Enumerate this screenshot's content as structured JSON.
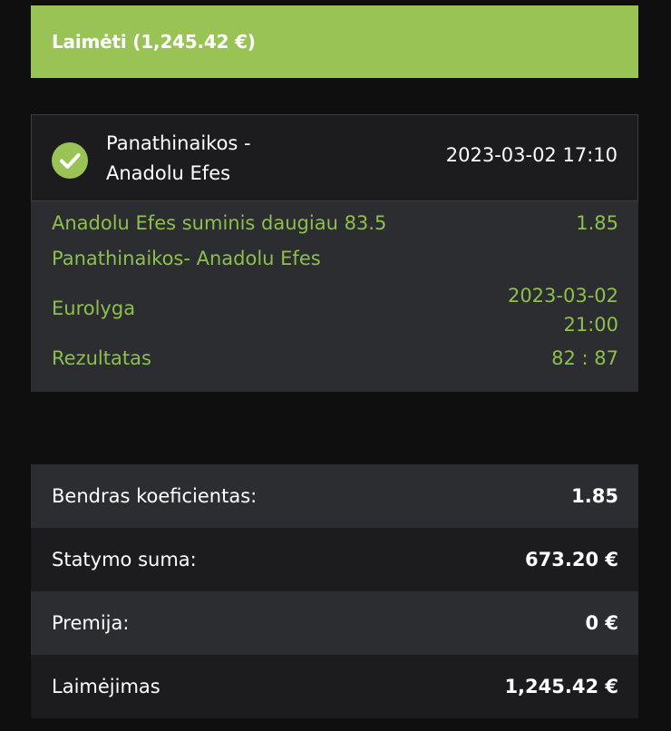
{
  "banner": {
    "text": "Laimėti (1,245.42 €)"
  },
  "bet": {
    "match": {
      "line1": "Panathinaikos -",
      "line2": "Anadolu Efes"
    },
    "datetime": "2023-03-02 17:10",
    "selection": "Anadolu Efes suminis daugiau 83.5",
    "odds": "1.85",
    "event": "Panathinaikos- Anadolu Efes",
    "league": "Eurolyga",
    "event_date": "2023-03-02",
    "event_time": "21:00",
    "result_label": "Rezultatas",
    "result_value": "82 : 87"
  },
  "summary": {
    "rows": [
      {
        "label": "Bendras koeficientas:",
        "value": "1.85"
      },
      {
        "label": "Statymo suma:",
        "value": "673.20 €"
      },
      {
        "label": "Premija:",
        "value": "0 €"
      },
      {
        "label": "Laimėjimas",
        "value": "1,245.42 €"
      }
    ]
  },
  "colors": {
    "accent": "#99c355",
    "green_text": "#8cc04b",
    "background": "#0f0f0f",
    "panel": "#2c2d30",
    "panel_dark": "#1c1c1e"
  },
  "icons": {
    "status": "check-circle-icon"
  }
}
